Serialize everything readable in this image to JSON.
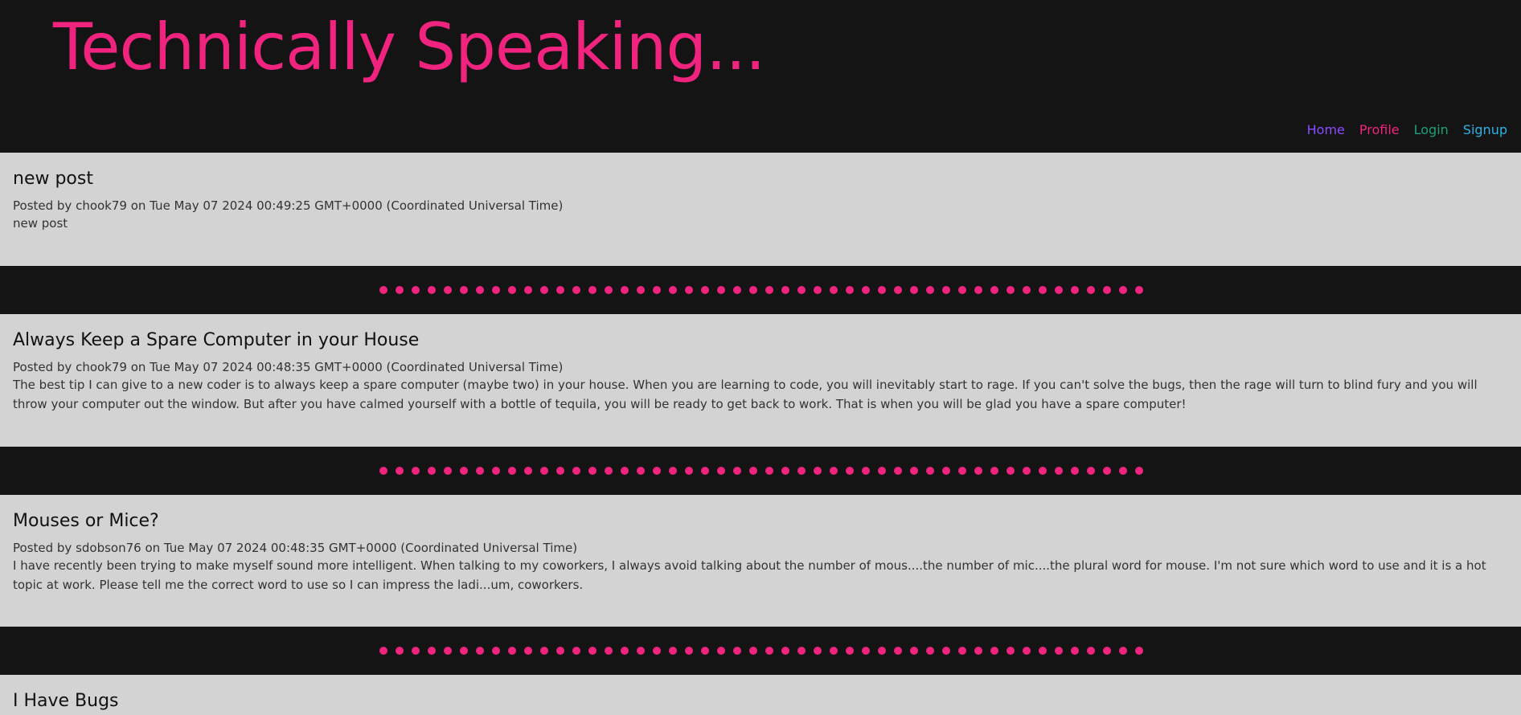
{
  "site": {
    "title": "Technically Speaking..."
  },
  "nav": {
    "home": "Home",
    "profile": "Profile",
    "login": "Login",
    "signup": "Signup"
  },
  "colors": {
    "accent": "#f0247f",
    "background": "#141414",
    "post_background": "#d3d3d3",
    "nav_home": "#8a4dff",
    "nav_profile": "#f0247f",
    "nav_login": "#1ea079",
    "nav_signup": "#2bb3e8"
  },
  "posts": [
    {
      "title": "new post",
      "meta": "Posted by chook79 on Tue May 07 2024 00:49:25 GMT+0000 (Coordinated Universal Time)",
      "body": "new post"
    },
    {
      "title": "Always Keep a Spare Computer in your House",
      "meta": "Posted by chook79 on Tue May 07 2024 00:48:35 GMT+0000 (Coordinated Universal Time)",
      "body": "The best tip I can give to a new coder is to always keep a spare computer (maybe two) in your house. When you are learning to code, you will inevitably start to rage. If you can't solve the bugs, then the rage will turn to blind fury and you will throw your computer out the window. But after you have calmed yourself with a bottle of tequila, you will be ready to get back to work. That is when you will be glad you have a spare computer!"
    },
    {
      "title": "Mouses or Mice?",
      "meta": "Posted by sdobson76 on Tue May 07 2024 00:48:35 GMT+0000 (Coordinated Universal Time)",
      "body": "I have recently been trying to make myself sound more intelligent. When talking to my coworkers, I always avoid talking about the number of mous....the number of mic....the plural word for mouse. I'm not sure which word to use and it is a hot topic at work. Please tell me the correct word to use so I can impress the ladi...um, coworkers."
    },
    {
      "title": "I Have Bugs"
    }
  ]
}
